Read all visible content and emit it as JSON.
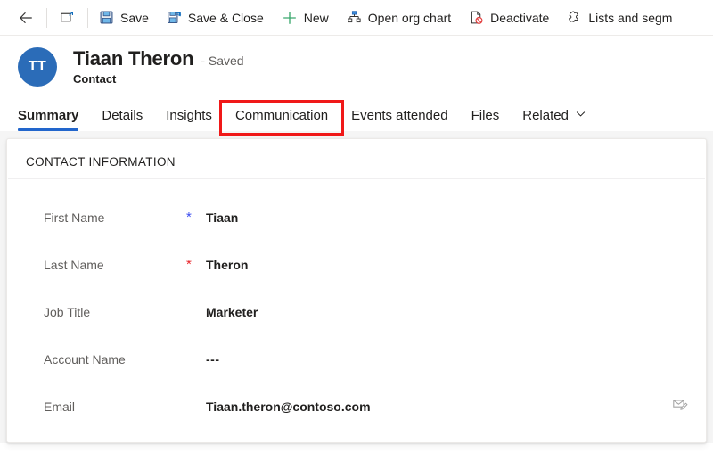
{
  "command_bar": {
    "items": [
      {
        "icon": "back-arrow-icon",
        "label": "",
        "name": "back-button"
      },
      {
        "icon": "popout-icon",
        "label": "",
        "name": "open-in-new-window-button"
      },
      {
        "icon": "save-icon",
        "label": "Save",
        "name": "save-button"
      },
      {
        "icon": "save-and-close-icon",
        "label": "Save & Close",
        "name": "save-and-close-button"
      },
      {
        "icon": "plus-icon",
        "label": "New",
        "name": "new-button"
      },
      {
        "icon": "org-chart-icon",
        "label": "Open org chart",
        "name": "open-org-chart-button"
      },
      {
        "icon": "deactivate-icon",
        "label": "Deactivate",
        "name": "deactivate-button"
      },
      {
        "icon": "lists-segments-icon",
        "label": "Lists and segm",
        "name": "lists-and-segments-button"
      }
    ]
  },
  "record": {
    "avatar_initials": "TT",
    "title": "Tiaan Theron",
    "status": "- Saved",
    "subtitle": "Contact"
  },
  "tabs": [
    {
      "label": "Summary",
      "name": "tab-summary",
      "active": true,
      "highlighted": false,
      "chevron": false
    },
    {
      "label": "Details",
      "name": "tab-details",
      "active": false,
      "highlighted": false,
      "chevron": false
    },
    {
      "label": "Insights",
      "name": "tab-insights",
      "active": false,
      "highlighted": false,
      "chevron": false
    },
    {
      "label": "Communication",
      "name": "tab-communication",
      "active": false,
      "highlighted": true,
      "chevron": false
    },
    {
      "label": "Events attended",
      "name": "tab-events-attended",
      "active": false,
      "highlighted": false,
      "chevron": false
    },
    {
      "label": "Files",
      "name": "tab-files",
      "active": false,
      "highlighted": false,
      "chevron": false
    },
    {
      "label": "Related",
      "name": "tab-related",
      "active": false,
      "highlighted": false,
      "chevron": true
    }
  ],
  "form": {
    "section_title": "CONTACT INFORMATION",
    "fields": [
      {
        "label": "First Name",
        "required": "blue",
        "value": "Tiaan",
        "action_icon": ""
      },
      {
        "label": "Last Name",
        "required": "red",
        "value": "Theron",
        "action_icon": ""
      },
      {
        "label": "Job Title",
        "required": "",
        "value": "Marketer",
        "action_icon": ""
      },
      {
        "label": "Account Name",
        "required": "",
        "value": "---",
        "action_icon": ""
      },
      {
        "label": "Email",
        "required": "",
        "value": "Tiaan.theron@contoso.com",
        "action_icon": "email-compose-icon"
      }
    ]
  },
  "colors": {
    "accent_blue": "#2266cc",
    "avatar_blue": "#2b6cb8",
    "highlight_red": "#f01818",
    "required_red": "#e8262c",
    "required_blue": "#3b4cf0"
  }
}
